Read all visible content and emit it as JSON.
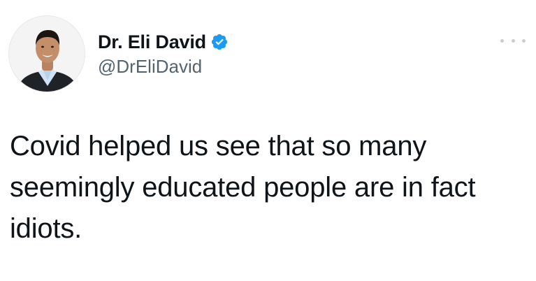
{
  "author": {
    "display_name": "Dr. Eli David",
    "handle": "@DrEliDavid",
    "verified": true,
    "avatar_icon": "profile-photo"
  },
  "tweet": {
    "text": "Covid helped us see that so many\nseemingly educated people are in fact\nidiots."
  },
  "icons": {
    "verified": "verified-badge-icon",
    "more": "more-options-icon"
  },
  "colors": {
    "verified_blue": "#1d9bf0",
    "handle_gray": "#536471",
    "text": "#0f1419"
  }
}
